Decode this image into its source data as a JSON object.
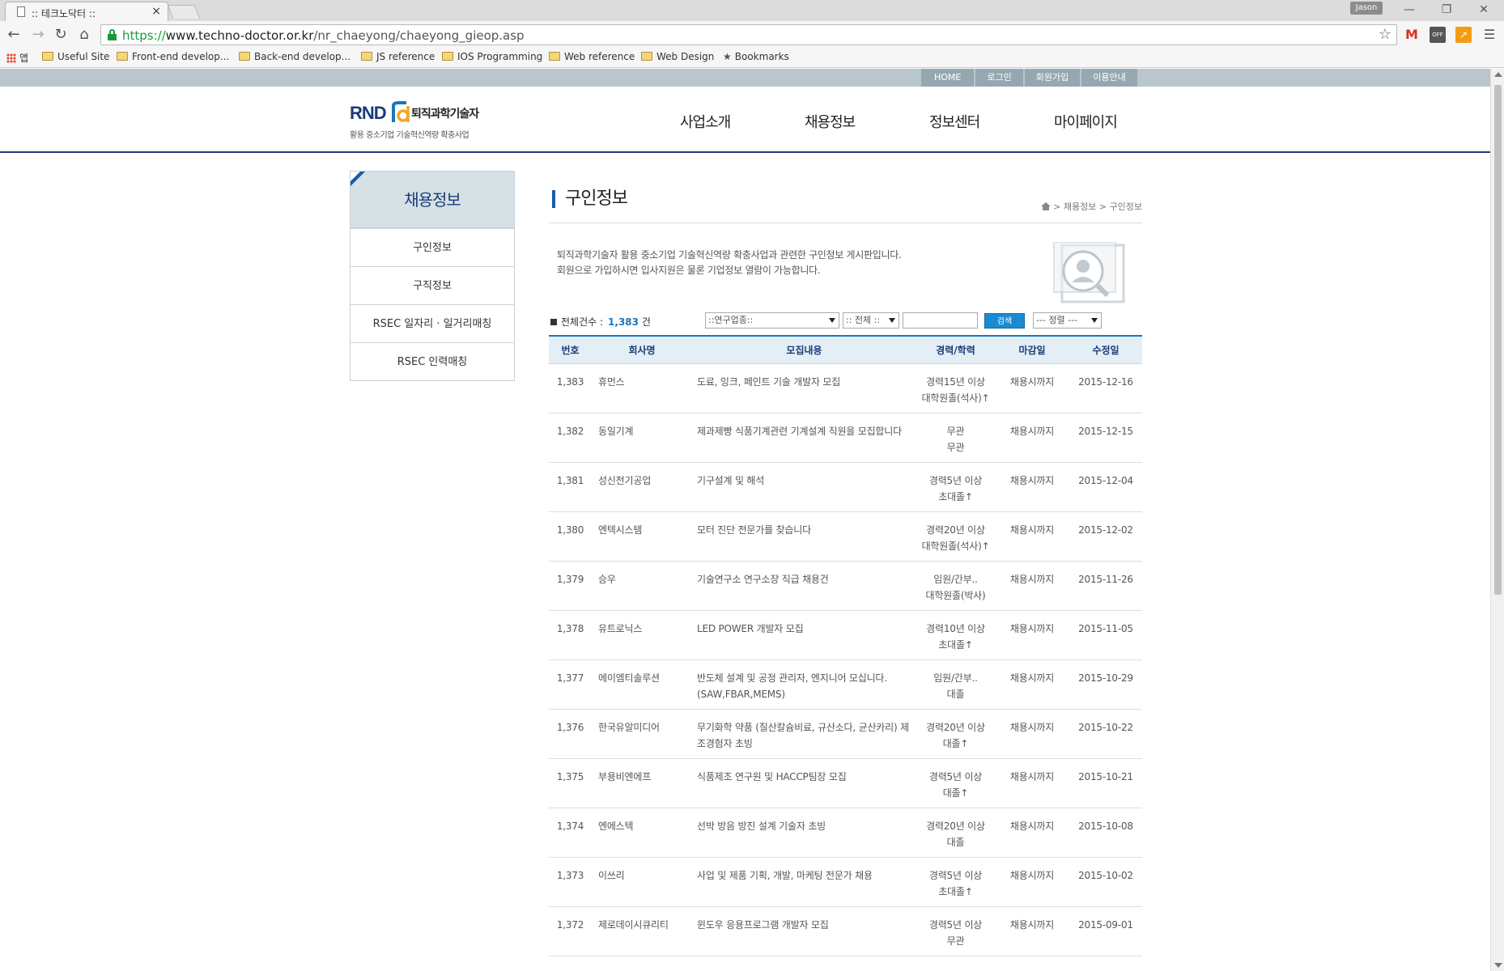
{
  "browser": {
    "tab_title": ":: 테크노닥터 ::",
    "tab_close": "×",
    "user_badge": "Jason",
    "url_scheme": "https://",
    "url_host": "www.techno-doctor.or.kr",
    "url_path": "/nr_chaeyong/chaeyong_gieop.asp",
    "bookmarks": [
      {
        "label": "앱",
        "icon": "apps-icon"
      },
      {
        "label": "Useful Site",
        "icon": "folder-icon"
      },
      {
        "label": "Front-end develop...",
        "icon": "folder-icon"
      },
      {
        "label": "Back-end develop...",
        "icon": "folder-icon"
      },
      {
        "label": "JS reference",
        "icon": "folder-icon"
      },
      {
        "label": "IOS Programming",
        "icon": "folder-icon"
      },
      {
        "label": "Web reference",
        "icon": "folder-icon"
      },
      {
        "label": "Web Design",
        "icon": "folder-icon"
      },
      {
        "label": "Bookmarks",
        "icon": "star-icon"
      }
    ],
    "ext_off_label": "OFF"
  },
  "site": {
    "util_links": [
      "HOME",
      "로그인",
      "회원가입",
      "이용안내"
    ],
    "logo_rnd": "RND",
    "logo_name": "퇴직과학기술자",
    "logo_tagline": "활용 중소기업 기술혁신역량 확충사업",
    "gnb": [
      "사업소개",
      "채용정보",
      "정보센터",
      "마이페이지"
    ],
    "colors": {
      "navy": "#1b3b7a",
      "accent": "#1b75bb",
      "button": "#1a8bd2"
    }
  },
  "sidebar": {
    "title": "채용정보",
    "items": [
      "구인정보",
      "구직정보",
      "RSEC 일자리 · 일거리매칭",
      "RSEC 인력매칭"
    ]
  },
  "content": {
    "title": "구인정보",
    "breadcrumb": "> 채용정보 > 구인정보",
    "intro_line1": "퇴직과학기술자 활용 중소기업 기술혁신역량 확충사업과 관련한 구인정보 게시판입니다.",
    "intro_line2": "회원으로 가입하시면 입사지원은 물론 기업정보 열람이 가능합니다.",
    "total_label": "전체건수 :",
    "total_count": "1,383",
    "total_unit": "건",
    "filter_category": "::연구업종::",
    "filter_all": ":: 전체 ::",
    "search_button": "검색",
    "sort_select": "--- 정렬 ---"
  },
  "table": {
    "headers": [
      "번호",
      "회사명",
      "모집내용",
      "경력/학력",
      "마감일",
      "수정일"
    ],
    "rows": [
      {
        "no": "1,383",
        "company": "휴먼스",
        "title": "도료, 잉크, 페인트 기술 개발자 모집",
        "career": "경력15년 이상",
        "edu": "대학원졸(석사)↑",
        "deadline": "채용시까지",
        "date": "2015-12-16"
      },
      {
        "no": "1,382",
        "company": "동일기계",
        "title": "제과제빵 식품기계관련 기계설계 직원을 모집합니다",
        "career": "무관",
        "edu": "무관",
        "deadline": "채용시까지",
        "date": "2015-12-15"
      },
      {
        "no": "1,381",
        "company": "성신전기공업",
        "title": "기구설계 및 해석",
        "career": "경력5년 이상",
        "edu": "초대졸↑",
        "deadline": "채용시까지",
        "date": "2015-12-04"
      },
      {
        "no": "1,380",
        "company": "엔텍시스템",
        "title": "모터 진단 전문가를 찾습니다",
        "career": "경력20년 이상",
        "edu": "대학원졸(석사)↑",
        "deadline": "채용시까지",
        "date": "2015-12-02"
      },
      {
        "no": "1,379",
        "company": "승우",
        "title": "기술연구소 연구소장 직급 채용건",
        "career": "임원/간부..",
        "edu": "대학원졸(박사)",
        "deadline": "채용시까지",
        "date": "2015-11-26"
      },
      {
        "no": "1,378",
        "company": "유트로닉스",
        "title": "LED POWER 개발자 모집",
        "career": "경력10년 이상",
        "edu": "초대졸↑",
        "deadline": "채용시까지",
        "date": "2015-11-05"
      },
      {
        "no": "1,377",
        "company": "에이엠티솔루션",
        "title": "반도체 설계 및 공정 관리자, 엔지니어 모십니다.(SAW,FBAR,MEMS)",
        "career": "임원/간부..",
        "edu": "대졸",
        "deadline": "채용시까지",
        "date": "2015-10-29"
      },
      {
        "no": "1,376",
        "company": "한국유알미디어",
        "title": "무기화학 약품 (질산칼슘비료, 규산소다, 균산카리) 제조경험자 초빙",
        "career": "경력20년 이상",
        "edu": "대졸↑",
        "deadline": "채용시까지",
        "date": "2015-10-22"
      },
      {
        "no": "1,375",
        "company": "부용비엔에프",
        "title": "식품제조 연구원 및 HACCP팀장 모집",
        "career": "경력5년 이상",
        "edu": "대졸↑",
        "deadline": "채용시까지",
        "date": "2015-10-21"
      },
      {
        "no": "1,374",
        "company": "엔에스텍",
        "title": "선박 방음 방진 설계 기술자 초빙",
        "career": "경력20년 이상",
        "edu": "대졸",
        "deadline": "채용시까지",
        "date": "2015-10-08"
      },
      {
        "no": "1,373",
        "company": "이쓰리",
        "title": "사업 및 제품 기획, 개발, 마케팅 전문가 채용",
        "career": "경력5년 이상",
        "edu": "초대졸↑",
        "deadline": "채용시까지",
        "date": "2015-10-02"
      },
      {
        "no": "1,372",
        "company": "제로데이시큐리티",
        "title": "윈도우 응용프로그램 개발자 모집",
        "career": "경력5년 이상",
        "edu": "무관",
        "deadline": "채용시까지",
        "date": "2015-09-01"
      }
    ]
  }
}
